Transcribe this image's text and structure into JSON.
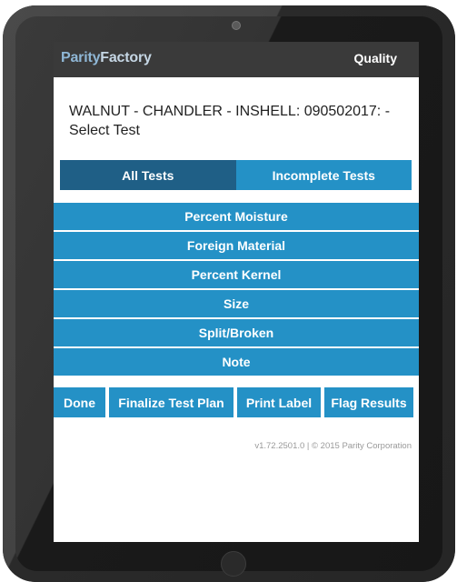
{
  "app": {
    "brand_part1": "Parity",
    "brand_part2": "Factory",
    "module": "Quality"
  },
  "page": {
    "title": "WALNUT - CHANDLER - INSHELL: 090502017: - Select Test"
  },
  "tabs": [
    {
      "label": "All Tests",
      "active": true
    },
    {
      "label": "Incomplete Tests",
      "active": false
    }
  ],
  "tests": [
    {
      "label": "Percent Moisture"
    },
    {
      "label": "Foreign Material"
    },
    {
      "label": "Percent Kernel"
    },
    {
      "label": "Size"
    },
    {
      "label": "Split/Broken"
    },
    {
      "label": "Note"
    }
  ],
  "actions": {
    "done": "Done",
    "finalize": "Finalize Test Plan",
    "print": "Print Label",
    "flag": "Flag Results"
  },
  "footer": {
    "version": "v1.72.2501.0 | © 2015 Parity Corporation"
  },
  "colors": {
    "primary": "#2491c6",
    "active_tab": "#1f5f86",
    "topbar": "#3a3a3a"
  }
}
